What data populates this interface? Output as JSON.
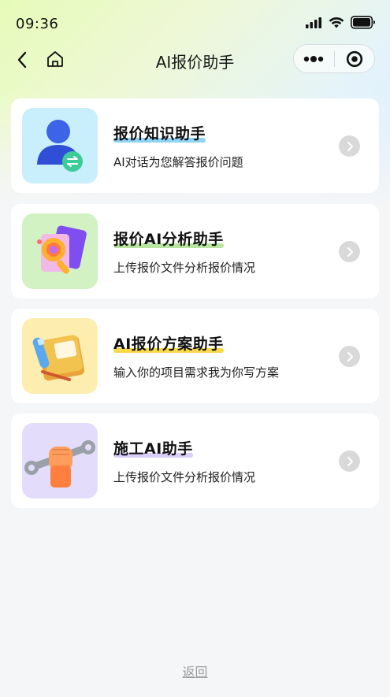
{
  "status_bar": {
    "time": "09:36"
  },
  "nav": {
    "title": "AI报价助手"
  },
  "cards": [
    {
      "title": "报价知识助手",
      "desc": "AI对话为您解答报价问题",
      "icon": "user-chat-icon",
      "icon_bg": "#c9eefc",
      "highlight": "#8fd3f5"
    },
    {
      "title": "报价AI分析助手",
      "desc": "上传报价文件分析报价情况",
      "icon": "magnifier-document-icon",
      "icon_bg": "#d3f2c4",
      "highlight": "#b8e6a0"
    },
    {
      "title": "AI报价方案助手",
      "desc": "输入你的项目需求我为你写方案",
      "icon": "notebook-pen-icon",
      "icon_bg": "#fdeeb0",
      "highlight": "#f7d94a"
    },
    {
      "title": "施工AI助手",
      "desc": "上传报价文件分析报价情况",
      "icon": "wrench-hand-icon",
      "icon_bg": "#e3dcfb",
      "highlight": "#d9cdfa"
    }
  ],
  "footer": {
    "back_label": "返回"
  }
}
